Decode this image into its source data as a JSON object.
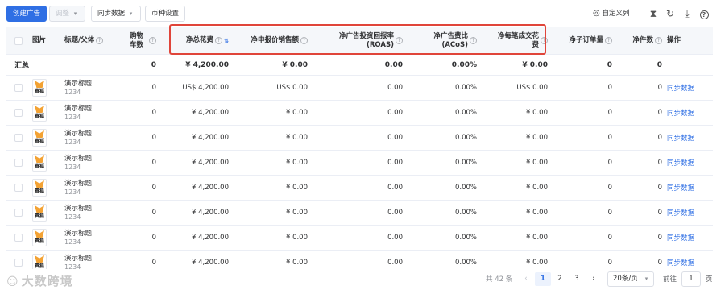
{
  "toolbar": {
    "create_ad": "创建广告",
    "adjust": "调整",
    "sync_data": "同步数据",
    "currency_settings": "币种设置",
    "custom_columns": "自定义列"
  },
  "icons": {
    "custom_columns": "settings-circle-icon",
    "hourglass": "hourglass-icon",
    "refresh": "refresh-icon",
    "download": "download-icon",
    "help": "help-icon"
  },
  "columns": {
    "image": "图片",
    "title": "标题/父体",
    "cart": "购物车数",
    "net_spend": "净总花费",
    "net_sales": "净申报价销售额",
    "roas": "净广告投资回报率(ROAS)",
    "acos": "净广告费比(ACoS)",
    "cpa": "净每笔成交花费",
    "orders": "净子订单量",
    "units": "净件数",
    "ops": "操作"
  },
  "summary": {
    "label": "汇总",
    "cart": "0",
    "net_spend": "¥ 4,200.00",
    "net_sales": "¥ 0.00",
    "roas": "0.00",
    "acos": "0.00%",
    "cpa": "¥ 0.00",
    "orders": "0",
    "units": "0"
  },
  "rows": [
    {
      "title": "演示标题",
      "sub": "1234",
      "brand": "赛狐",
      "cart": "0",
      "net_spend": "US$ 4,200.00",
      "net_sales": "US$ 0.00",
      "roas": "0.00",
      "acos": "0.00%",
      "cpa": "US$ 0.00",
      "orders": "0",
      "units": "0",
      "action": "同步数据"
    },
    {
      "title": "演示标题",
      "sub": "1234",
      "brand": "赛狐",
      "cart": "0",
      "net_spend": "¥ 4,200.00",
      "net_sales": "¥ 0.00",
      "roas": "0.00",
      "acos": "0.00%",
      "cpa": "¥ 0.00",
      "orders": "0",
      "units": "0",
      "action": "同步数据"
    },
    {
      "title": "演示标题",
      "sub": "1234",
      "brand": "赛狐",
      "cart": "0",
      "net_spend": "¥ 4,200.00",
      "net_sales": "¥ 0.00",
      "roas": "0.00",
      "acos": "0.00%",
      "cpa": "¥ 0.00",
      "orders": "0",
      "units": "0",
      "action": "同步数据"
    },
    {
      "title": "演示标题",
      "sub": "1234",
      "brand": "赛狐",
      "cart": "0",
      "net_spend": "¥ 4,200.00",
      "net_sales": "¥ 0.00",
      "roas": "0.00",
      "acos": "0.00%",
      "cpa": "¥ 0.00",
      "orders": "0",
      "units": "0",
      "action": "同步数据"
    },
    {
      "title": "演示标题",
      "sub": "1234",
      "brand": "赛狐",
      "cart": "0",
      "net_spend": "¥ 4,200.00",
      "net_sales": "¥ 0.00",
      "roas": "0.00",
      "acos": "0.00%",
      "cpa": "¥ 0.00",
      "orders": "0",
      "units": "0",
      "action": "同步数据"
    },
    {
      "title": "演示标题",
      "sub": "1234",
      "brand": "赛狐",
      "cart": "0",
      "net_spend": "¥ 4,200.00",
      "net_sales": "¥ 0.00",
      "roas": "0.00",
      "acos": "0.00%",
      "cpa": "¥ 0.00",
      "orders": "0",
      "units": "0",
      "action": "同步数据"
    },
    {
      "title": "演示标题",
      "sub": "1234",
      "brand": "赛狐",
      "cart": "0",
      "net_spend": "¥ 4,200.00",
      "net_sales": "¥ 0.00",
      "roas": "0.00",
      "acos": "0.00%",
      "cpa": "¥ 0.00",
      "orders": "0",
      "units": "0",
      "action": "同步数据"
    },
    {
      "title": "演示标题",
      "sub": "1234",
      "brand": "赛狐",
      "cart": "0",
      "net_spend": "¥ 4,200.00",
      "net_sales": "¥ 0.00",
      "roas": "0.00",
      "acos": "0.00%",
      "cpa": "¥ 0.00",
      "orders": "0",
      "units": "0",
      "action": "同步数据"
    }
  ],
  "pagination": {
    "total": "共 42 条",
    "pages": [
      "1",
      "2",
      "3"
    ],
    "current": "1",
    "page_size": "20条/页",
    "goto_label": "前往",
    "goto_value": "1",
    "page_unit": "页"
  },
  "watermark": "大数跨境",
  "colors": {
    "primary": "#2f6fe4",
    "highlight": "#e0453a"
  }
}
